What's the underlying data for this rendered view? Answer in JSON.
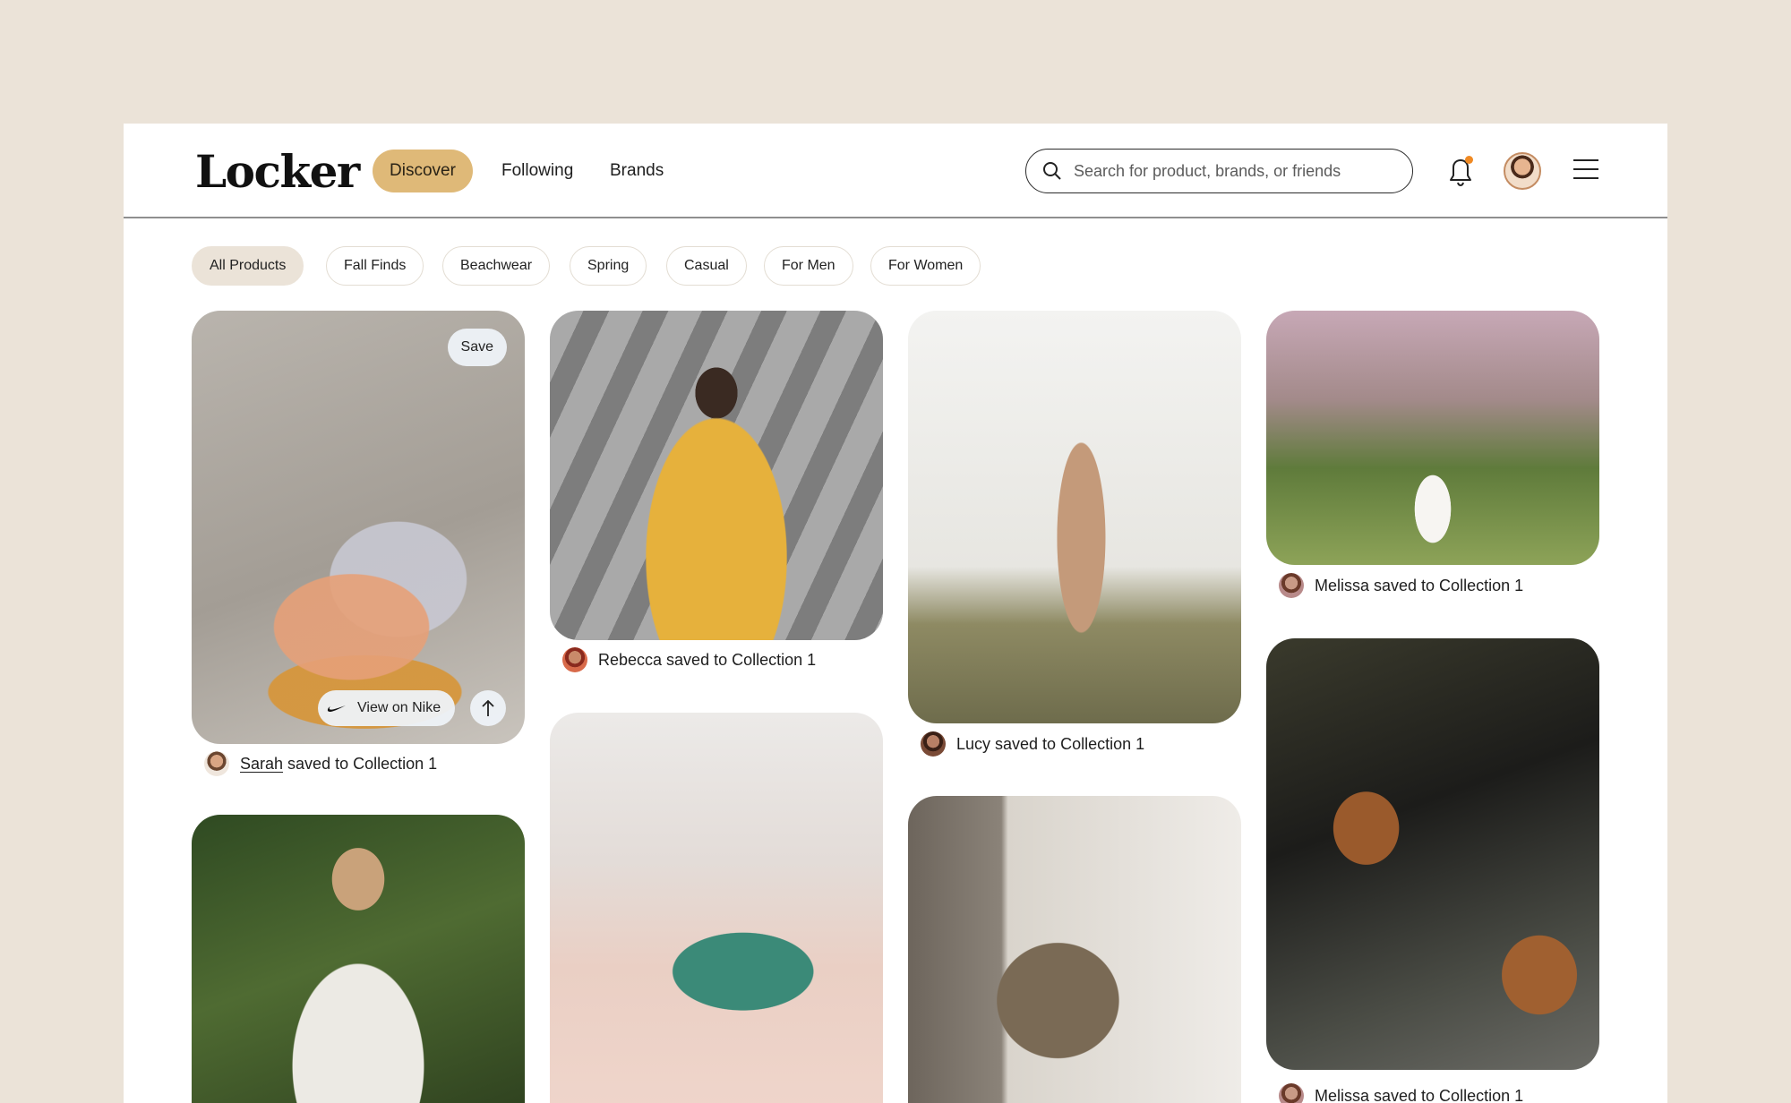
{
  "brand": {
    "logo": "Locker"
  },
  "nav": {
    "tabs": [
      "Discover",
      "Following",
      "Brands"
    ],
    "active": "Discover"
  },
  "search": {
    "placeholder": "Search for product, brands, or friends"
  },
  "header_icons": [
    "search-icon",
    "bell-icon",
    "avatar",
    "menu-icon"
  ],
  "notification_dot_color": "#f08a24",
  "accent_color": "#dfb978",
  "filters": [
    "All Products",
    "Fall Finds",
    "Beachwear",
    "Spring",
    "Casual",
    "For Men",
    "For Women"
  ],
  "cards": [
    {
      "id": "sneakers",
      "user": "Sarah",
      "caption_rest": " saved to Collection 1",
      "save_label": "Save",
      "view_label": "View on Nike"
    },
    {
      "id": "yellow-dress",
      "caption": "Rebecca saved to Collection 1"
    },
    {
      "id": "trench-coat",
      "caption": "Lucy saved to Collection 1"
    },
    {
      "id": "cherry-trees",
      "caption": "Melissa saved to Collection 1"
    },
    {
      "id": "white-top"
    },
    {
      "id": "green-shoe"
    },
    {
      "id": "sweater"
    },
    {
      "id": "brown-boots",
      "caption": "Melissa saved to Collection 1"
    }
  ]
}
